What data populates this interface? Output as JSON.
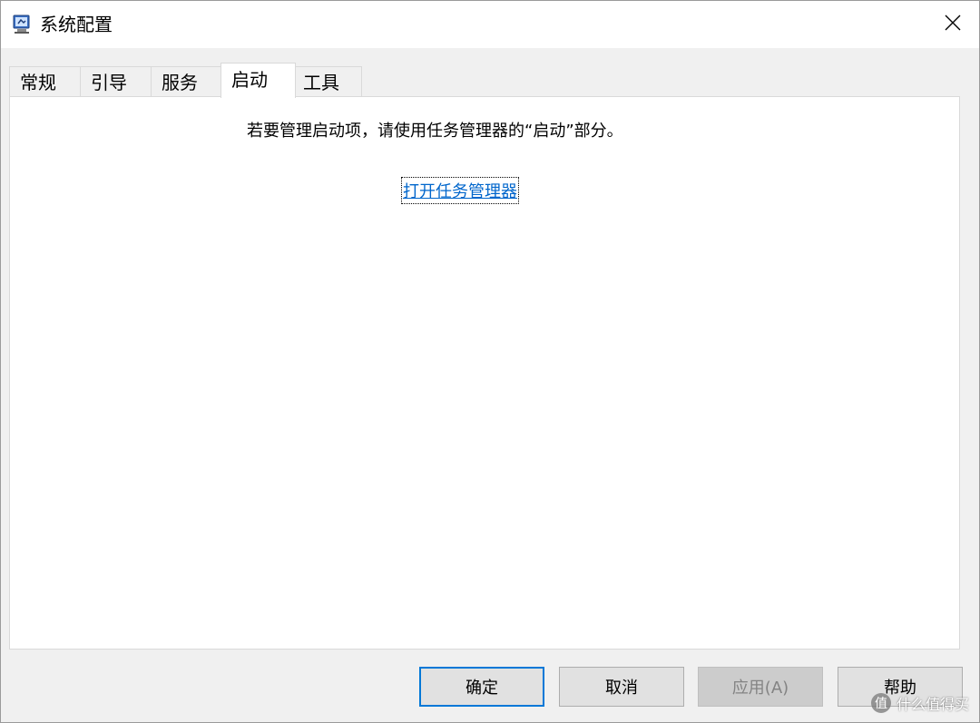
{
  "window": {
    "title": "系统配置",
    "close_glyph": "✕"
  },
  "tabs": [
    {
      "label": "常规",
      "active": false
    },
    {
      "label": "引导",
      "active": false
    },
    {
      "label": "服务",
      "active": false
    },
    {
      "label": "启动",
      "active": true
    },
    {
      "label": "工具",
      "active": false
    }
  ],
  "panel": {
    "info_text": "若要管理启动项，请使用任务管理器的“启动”部分。",
    "link_text": "打开任务管理器"
  },
  "buttons": {
    "ok": "确定",
    "cancel": "取消",
    "apply": "应用(A)",
    "help": "帮助"
  },
  "watermark": {
    "badge": "值",
    "text": "什么值得买"
  },
  "colors": {
    "link": "#0066cc",
    "primary_border": "#0078d7"
  }
}
